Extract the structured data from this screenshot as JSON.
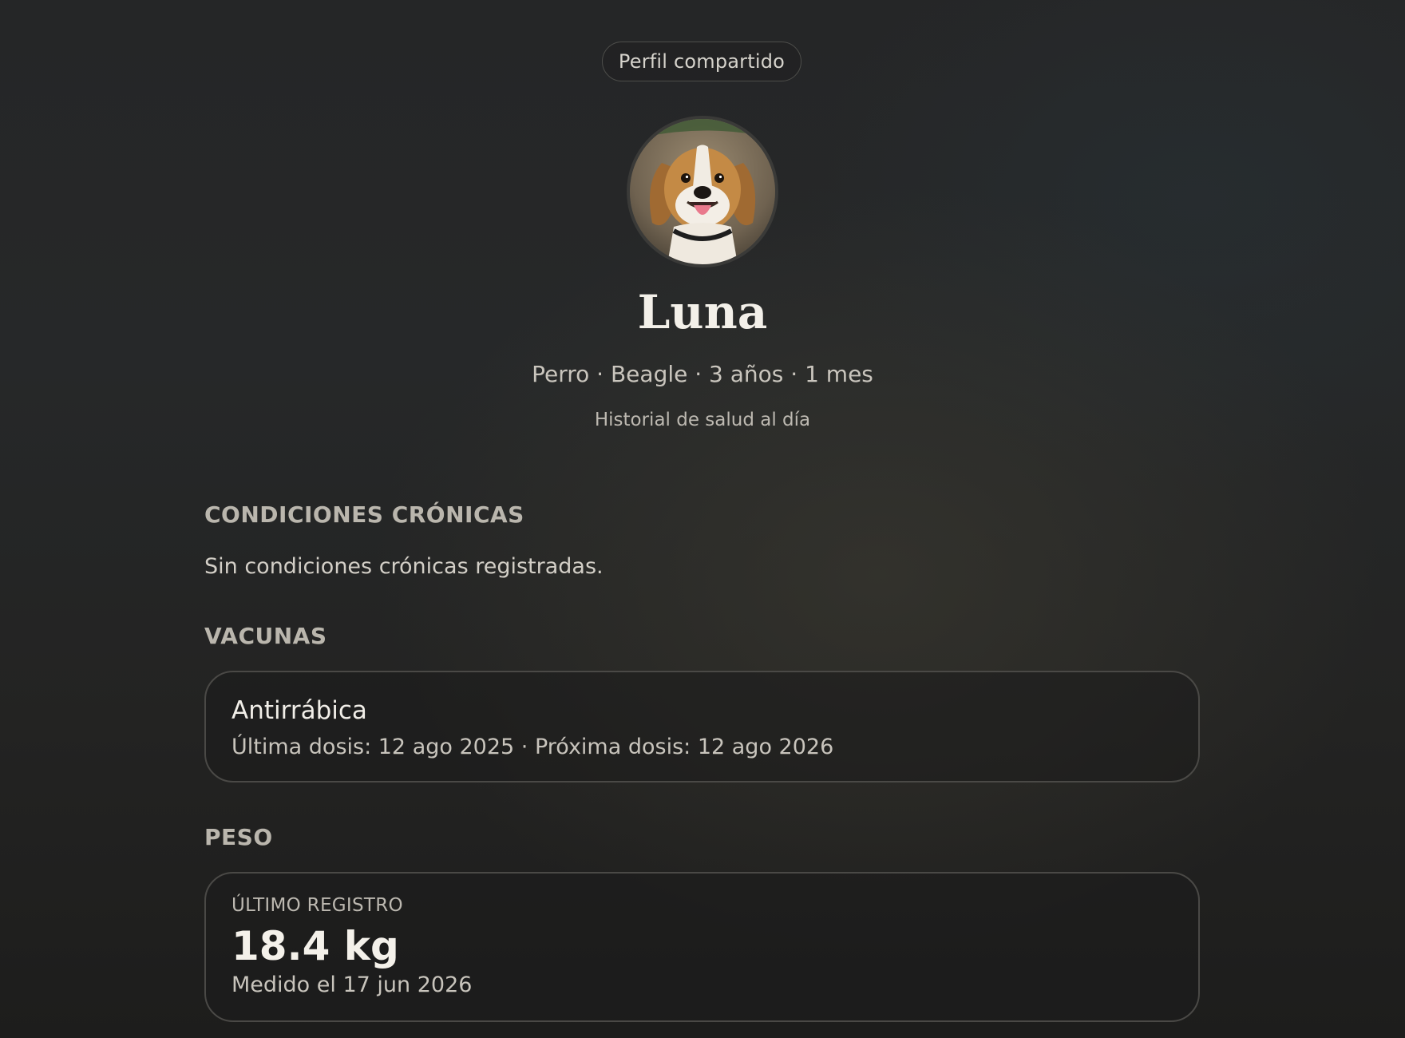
{
  "header": {
    "shared_label": "Perfil compartido"
  },
  "pet": {
    "photo_icon": "dog-photo",
    "name": "Luna",
    "meta": "Perro · Beagle · 3 años · 1 mes",
    "status": "Historial de salud al día"
  },
  "chronic": {
    "title": "CONDICIONES CRÓNICAS",
    "empty_text": "Sin condiciones crónicas registradas."
  },
  "vaccines": {
    "title": "VACUNAS",
    "items": [
      {
        "name": "Antirrábica",
        "dates": "Última dosis: 12 ago 2025 · Próxima dosis: 12 ago 2026"
      }
    ]
  },
  "weight": {
    "title": "PESO",
    "label": "ÚLTIMO REGISTRO",
    "value": "18.4 kg",
    "date": "Medido el 17 jun 2026"
  }
}
